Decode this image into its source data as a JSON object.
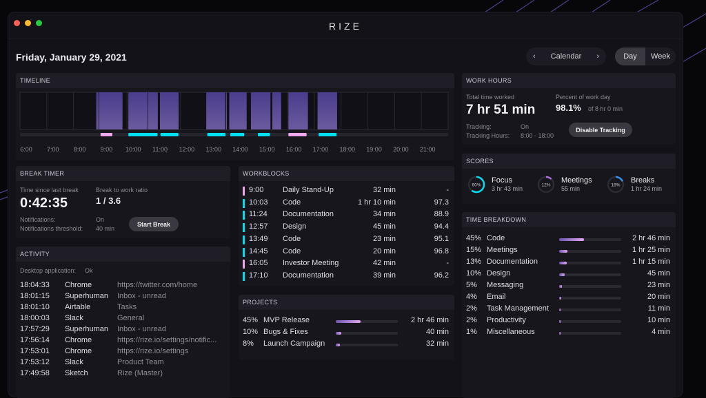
{
  "window": {
    "title": "RIZE"
  },
  "header": {
    "date": "Friday, January 29, 2021",
    "calendar_label": "Calendar",
    "view_day": "Day",
    "view_week": "Week",
    "active_view": "Day"
  },
  "timeline": {
    "title": "TIMELINE",
    "hour_labels": [
      "6:00",
      "7:00",
      "8:00",
      "9:00",
      "10:00",
      "11:00",
      "12:00",
      "13:00",
      "14:00",
      "15:00",
      "16:00",
      "17:00",
      "18:00",
      "19:00",
      "20:00",
      "21:00"
    ],
    "activity_blocks": [
      [
        8.85,
        8.94
      ],
      [
        8.96,
        9.83
      ],
      [
        10.05,
        10.77
      ],
      [
        10.79,
        11.15
      ],
      [
        11.23,
        11.93
      ],
      [
        12.96,
        13.67
      ],
      [
        13.7,
        13.73
      ],
      [
        13.82,
        14.47
      ],
      [
        14.63,
        15.36
      ],
      [
        15.43,
        15.76
      ],
      [
        16.03,
        16.76
      ],
      [
        17.12,
        17.85
      ]
    ],
    "workblock_strip": [
      {
        "start": 9.01,
        "end": 9.45,
        "kind": "meeting"
      },
      {
        "start": 10.05,
        "end": 11.14,
        "kind": "focus"
      },
      {
        "start": 11.25,
        "end": 11.92,
        "kind": "focus"
      },
      {
        "start": 13.0,
        "end": 13.68,
        "kind": "focus"
      },
      {
        "start": 13.86,
        "end": 14.38,
        "kind": "focus"
      },
      {
        "start": 14.89,
        "end": 15.34,
        "kind": "focus"
      },
      {
        "start": 16.03,
        "end": 16.71,
        "kind": "meeting"
      },
      {
        "start": 17.16,
        "end": 17.83,
        "kind": "focus"
      }
    ]
  },
  "colors": {
    "focus": "#00e0f0",
    "meeting": "#f0a8ec",
    "block": "#5b4a9a",
    "accent_blue": "#3a8ee8",
    "accent_purple": "#b070e0"
  },
  "work_hours": {
    "title": "WORK HOURS",
    "total_label": "Total time worked",
    "total": "7 hr 51 min",
    "percent_label": "Percent of work day",
    "percent": "98.1%",
    "percent_of": "of 8 hr 0 min",
    "tracking_label": "Tracking:",
    "tracking": "On",
    "hours_label": "Tracking Hours:",
    "hours": "8:00 - 18:00",
    "button": "Disable Tracking"
  },
  "scores": {
    "title": "SCORES",
    "items": [
      {
        "pct_label": "60%",
        "pct": 60,
        "name": "Focus",
        "time": "3 hr 43 min",
        "color": "#00e0f0"
      },
      {
        "pct_label": "12%",
        "pct": 12,
        "name": "Meetings",
        "time": "55 min",
        "color": "#b070e0"
      },
      {
        "pct_label": "18%",
        "pct": 18,
        "name": "Breaks",
        "time": "1 hr 24 min",
        "color": "#3a8ee8"
      }
    ]
  },
  "break_timer": {
    "title": "BREAK TIMER",
    "since_label": "Time since last break",
    "since": "0:42:35",
    "ratio_label": "Break to work ratio",
    "ratio": "1 / 3.6",
    "notif_label": "Notifications:",
    "notif": "On",
    "threshold_label": "Notifications threshold:",
    "threshold": "40 min",
    "button": "Start Break"
  },
  "activity": {
    "title": "ACTIVITY",
    "desktop_label": "Desktop application:",
    "desktop": "Ok",
    "rows": [
      [
        "18:04:33",
        "Chrome",
        "https://twitter.com/home"
      ],
      [
        "18:01:15",
        "Superhuman",
        "Inbox - unread"
      ],
      [
        "18:01:10",
        "Airtable",
        "Tasks"
      ],
      [
        "18:00:03",
        "Slack",
        "General"
      ],
      [
        "17:57:29",
        "Superhuman",
        "Inbox - unread"
      ],
      [
        "17:56:14",
        "Chrome",
        "https://rize.io/settings/notific..."
      ],
      [
        "17:53:01",
        "Chrome",
        "https://rize.io/settings"
      ],
      [
        "17:53:12",
        "Slack",
        "Product Team"
      ],
      [
        "17:49:58",
        "Sketch",
        "Rize (Master)"
      ]
    ]
  },
  "workblocks": {
    "title": "WORKBLOCKS",
    "rows": [
      {
        "time": "9:00",
        "name": "Daily Stand-Up",
        "duration": "32 min",
        "score": "-",
        "kind": "meeting"
      },
      {
        "time": "10:03",
        "name": "Code",
        "duration": "1 hr 10 min",
        "score": "97.3",
        "kind": "focus"
      },
      {
        "time": "11:24",
        "name": "Documentation",
        "duration": "34 min",
        "score": "88.9",
        "kind": "focus"
      },
      {
        "time": "12:57",
        "name": "Design",
        "duration": "45 min",
        "score": "94.4",
        "kind": "focus"
      },
      {
        "time": "13:49",
        "name": "Code",
        "duration": "23 min",
        "score": "95.1",
        "kind": "focus"
      },
      {
        "time": "14:45",
        "name": "Code",
        "duration": "20 min",
        "score": "96.8",
        "kind": "focus"
      },
      {
        "time": "16:05",
        "name": "Investor Meeting",
        "duration": "42 min",
        "score": "-",
        "kind": "meeting"
      },
      {
        "time": "17:10",
        "name": "Documentation",
        "duration": "39 min",
        "score": "96.2",
        "kind": "focus"
      }
    ]
  },
  "projects": {
    "title": "PROJECTS",
    "rows": [
      {
        "pct_label": "45%",
        "pct": 45,
        "name": "MVP Release",
        "time": "2 hr 46 min"
      },
      {
        "pct_label": "10%",
        "pct": 10,
        "name": "Bugs & Fixes",
        "time": "40 min"
      },
      {
        "pct_label": "8%",
        "pct": 8,
        "name": "Launch Campaign",
        "time": "32 min"
      }
    ]
  },
  "time_breakdown": {
    "title": "TIME BREAKDOWN",
    "rows": [
      {
        "pct_label": "45%",
        "pct": 45,
        "name": "Code",
        "time": "2 hr 46 min"
      },
      {
        "pct_label": "15%",
        "pct": 15,
        "name": "Meetings",
        "time": "1 hr 25 min"
      },
      {
        "pct_label": "13%",
        "pct": 13,
        "name": "Documentation",
        "time": "1 hr 15 min"
      },
      {
        "pct_label": "10%",
        "pct": 10,
        "name": "Design",
        "time": "45 min"
      },
      {
        "pct_label": "5%",
        "pct": 5,
        "name": "Messaging",
        "time": "23 min"
      },
      {
        "pct_label": "4%",
        "pct": 4,
        "name": "Email",
        "time": "20 min"
      },
      {
        "pct_label": "2%",
        "pct": 2,
        "name": "Task Management",
        "time": "11 min"
      },
      {
        "pct_label": "2%",
        "pct": 2,
        "name": "Productivity",
        "time": "10 min"
      },
      {
        "pct_label": "1%",
        "pct": 1,
        "name": "Miscellaneous",
        "time": "4 min"
      }
    ]
  }
}
